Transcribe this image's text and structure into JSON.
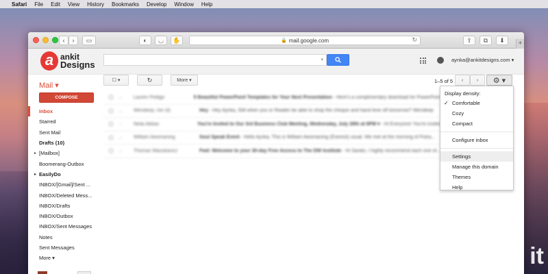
{
  "menubar": {
    "apple": "",
    "app": "Safari",
    "items": [
      "File",
      "Edit",
      "View",
      "History",
      "Bookmarks",
      "Develop",
      "Window",
      "Help"
    ]
  },
  "browser": {
    "url": "mail.google.com"
  },
  "header": {
    "logo_line1": "ankit",
    "logo_line2": "Designs",
    "logo_mark": "a",
    "search_placeholder": "",
    "account_email": "aynka@ankitdesigns.com ▾"
  },
  "toolbar": {
    "mail_label": "Mail ▾",
    "more_label": "More ▾",
    "pager_text": "1–5 of 5",
    "compose_label": "COMPOSE"
  },
  "sidebar": {
    "items": [
      {
        "label": "Inbox",
        "style": "active"
      },
      {
        "label": "Starred",
        "style": ""
      },
      {
        "label": "Sent Mail",
        "style": ""
      },
      {
        "label": "Drafts (10)",
        "style": "bold"
      },
      {
        "label": "[Mailbox]",
        "style": "tri"
      },
      {
        "label": "Boomerang-Outbox",
        "style": ""
      },
      {
        "label": "EasilyDo",
        "style": "bold tri"
      },
      {
        "label": "INBOX/[Gmail]/Sent ...",
        "style": ""
      },
      {
        "label": "INBOX/Deleted Mess...",
        "style": ""
      },
      {
        "label": "INBOX/Drafts",
        "style": ""
      },
      {
        "label": "INBOX/Outbox",
        "style": ""
      },
      {
        "label": "INBOX/Sent Messages",
        "style": ""
      },
      {
        "label": "Notes",
        "style": ""
      },
      {
        "label": "Sent Messages",
        "style": ""
      },
      {
        "label": "More ▾",
        "style": ""
      }
    ]
  },
  "emails": [
    {
      "from": "Lauren Pedigo",
      "subject": "5 Beautiful PowerPoint Templates for Your Next Presentation",
      "snippet": " - Here's a complimentary download for PowerPoint..."
    },
    {
      "from": "Wendeep, me (4)",
      "subject": "Hey",
      "snippet": " - Hey Aynka, Still when you or Reader be able to shop the cheque and hand time off tomorrow? Wendeep"
    },
    {
      "from": "Neila Abbas",
      "subject": "You're Invited to Our 3rd Business Club Meeting, Wednesday, July 29th at 6PM ▾",
      "snippet": " - Hi Everyone! You're invited..."
    },
    {
      "from": "William Awomaning",
      "subject": "Soul Speak Event",
      "snippet": " - Hello Aynka, This is William Awomaning (Everest) usual. We met at the morning of Putra..."
    },
    {
      "from": "Thomas Wasukavicz",
      "subject": "Fwd: Welcome to your 30-day Free Access to The DW Institute",
      "snippet": " - Hi Sarato, I highly recommend each one of..."
    }
  ],
  "settings_menu": {
    "header": "Display density:",
    "density": [
      {
        "label": "Comfortable",
        "checked": "✓"
      },
      {
        "label": "Cozy",
        "checked": ""
      },
      {
        "label": "Compact",
        "checked": ""
      }
    ],
    "configure": "Configure inbox",
    "items": [
      {
        "label": "Settings",
        "highlighted": true
      },
      {
        "label": "Manage this domain",
        "highlighted": false
      },
      {
        "label": "Themes",
        "highlighted": false
      },
      {
        "label": "Help",
        "highlighted": false
      }
    ]
  },
  "colors": {
    "gmail_red": "#dd4b39",
    "compose_red": "#d14836",
    "search_blue": "#4285f4"
  }
}
